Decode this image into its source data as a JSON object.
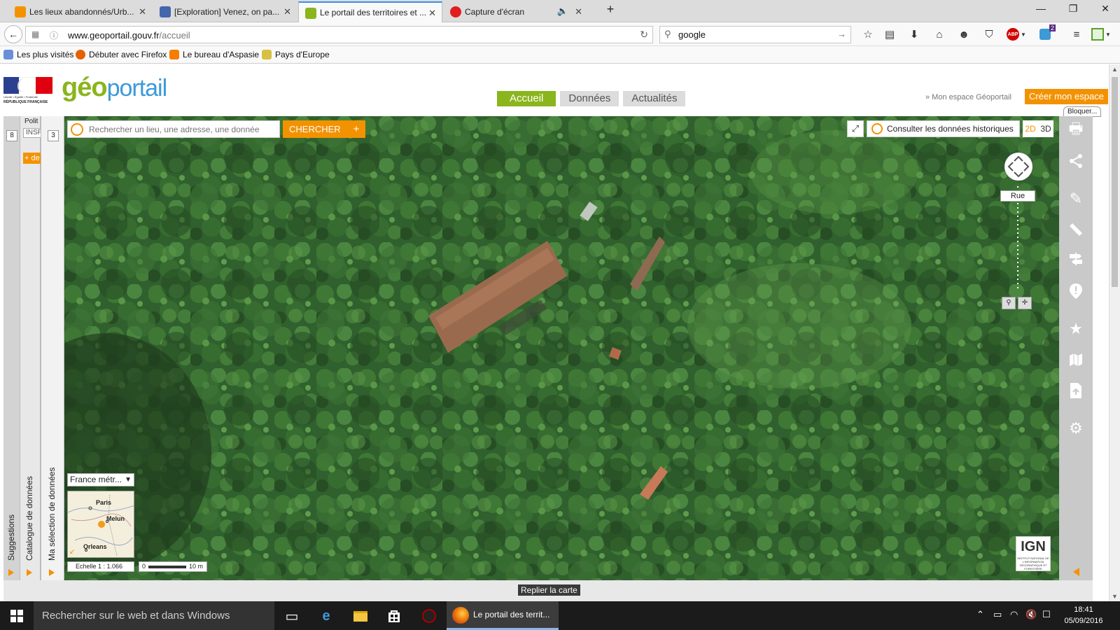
{
  "tabs": [
    {
      "title": "Les lieux abandonnés/Urb...",
      "favicon_color": "#f39200"
    },
    {
      "title": "[Exploration] Venez, on pa...",
      "favicon_color": "#4466aa"
    },
    {
      "title": "Le portail des territoires et ...",
      "favicon_color": "#8ab51c",
      "active": true
    },
    {
      "title": "Capture d'écran",
      "favicon_color": "#e01e1e"
    }
  ],
  "navbar": {
    "url_host": "www.geoportail.gouv.fr",
    "url_path": "/accueil",
    "search_value": "google",
    "abp_badge": "ABP",
    "notification_count": "2"
  },
  "bookmarks": [
    {
      "label": "Les plus visités",
      "icon_color": "#6a8fd8"
    },
    {
      "label": "Débuter avec Firefox",
      "icon_color": "#e66000"
    },
    {
      "label": "Le bureau d'Aspasie",
      "icon_color": "#f57d00"
    },
    {
      "label": "Pays d'Europe",
      "icon_color": "#d8c040"
    }
  ],
  "site": {
    "flag_lines": [
      "Liberté • Égalité • Fraternité",
      "RÉPUBLIQUE FRANÇAISE"
    ],
    "logo_geo": "géo",
    "logo_portail": "portail",
    "nav": [
      "Accueil",
      "Données",
      "Actualités"
    ],
    "mon_espace": "» Mon espace Géoportail",
    "creer_espace": "Créer mon espace",
    "bloquer": "Bloquer..."
  },
  "left_panels": {
    "suggestions": "Suggestions",
    "catalogue": "Catalogue de données",
    "catalogue_top": "Polit",
    "catalogue_sub": "INSP",
    "catalogue_add": "+ de",
    "ma_selection": "Ma sélection de données",
    "badge_suggestions": "8",
    "badge_selection": "3"
  },
  "map": {
    "search_placeholder": "Rechercher un lieu, une adresse, une donnée",
    "search_button": "CHERCHER",
    "plus_button": "+",
    "fullscreen": "⤢",
    "historique": "Consulter les données historiques",
    "mode_2d": "2D",
    "mode_3d": "3D",
    "zoom_level_label": "Rue",
    "minimap_region": "France métr...",
    "minimap_cities": [
      "Paris",
      "Melun",
      "Orleans"
    ],
    "scale_text": "Echelle 1 : 1.066",
    "scalebar_start": "0",
    "scalebar_end": "10 m",
    "ign_label": "IGN",
    "ign_sub": "INSTITUT NATIONAL DE L'INFORMATION GÉOGRAPHIQUE ET FORESTIÈRE",
    "replier": "Replier la carte"
  },
  "taskbar": {
    "search_placeholder": "Rechercher sur le web et dans Windows",
    "active_window": "Le portail des territ...",
    "time": "18:41",
    "date": "05/09/2016"
  },
  "colors": {
    "accent_orange": "#f39200",
    "geo_green": "#8ab51c",
    "portail_blue": "#3d9ad7",
    "forest": "#2f5a2b"
  }
}
